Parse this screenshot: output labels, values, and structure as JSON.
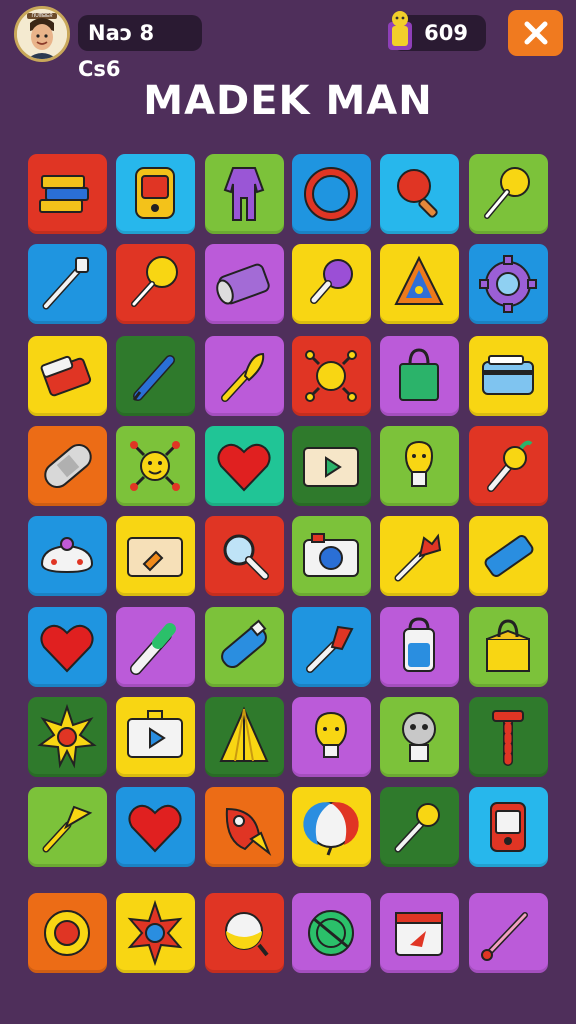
{
  "header": {
    "player_name": "Naɔ 8 Cs6",
    "coins": "609",
    "title": "MADEK MAN"
  },
  "avatar": {
    "badge_text": "ᑎᑌᗰᗷᗴᖇ"
  },
  "colors": {
    "background": "#4f2f5b",
    "red": "#e03524",
    "blue": "#1f95e0",
    "lightblue": "#27b7ec",
    "green": "#7cc23a",
    "darkgreen": "#2f7a2c",
    "yellow": "#f8d613",
    "purple": "#bb5bd9",
    "orange": "#ec6c16",
    "teal": "#20c596",
    "close": "#f07a1f"
  },
  "board": {
    "rows": [
      [
        {
          "color": "red",
          "icon": "books-icon"
        },
        {
          "color": "lightblue",
          "icon": "handheld-device-icon"
        },
        {
          "color": "green",
          "icon": "jumpsuit-icon"
        },
        {
          "color": "blue",
          "icon": "ring-icon"
        },
        {
          "color": "lightblue",
          "icon": "ping-pong-paddle-icon"
        },
        {
          "color": "green",
          "icon": "lollipop-wand-icon"
        }
      ],
      [
        {
          "color": "blue",
          "icon": "toothbrush-icon"
        },
        {
          "color": "red",
          "icon": "lollipop-icon"
        },
        {
          "color": "purple",
          "icon": "film-roll-icon"
        },
        {
          "color": "yellow",
          "icon": "maraca-icon"
        },
        {
          "color": "yellow",
          "icon": "warning-cone-icon"
        },
        {
          "color": "blue",
          "icon": "gear-icon"
        }
      ],
      [
        {
          "color": "yellow",
          "icon": "eraser-icon"
        },
        {
          "color": "darkgreen",
          "icon": "pen-icon"
        },
        {
          "color": "purple",
          "icon": "paint-brush-icon"
        },
        {
          "color": "red",
          "icon": "virus-icon"
        },
        {
          "color": "purple",
          "icon": "shopping-bag-icon"
        },
        {
          "color": "yellow",
          "icon": "wallet-icon"
        }
      ],
      [
        {
          "color": "orange",
          "icon": "bandage-icon"
        },
        {
          "color": "green",
          "icon": "bug-face-icon"
        },
        {
          "color": "teal",
          "icon": "heart-icon"
        },
        {
          "color": "darkgreen",
          "icon": "video-player-icon"
        },
        {
          "color": "green",
          "icon": "robot-bulb-icon"
        },
        {
          "color": "red",
          "icon": "torch-icon"
        }
      ],
      [
        {
          "color": "blue",
          "icon": "spaceship-icon"
        },
        {
          "color": "yellow",
          "icon": "folder-icon"
        },
        {
          "color": "red",
          "icon": "magnifier-icon"
        },
        {
          "color": "green",
          "icon": "camera-icon"
        },
        {
          "color": "yellow",
          "icon": "flower-wand-icon"
        },
        {
          "color": "yellow",
          "icon": "tube-icon"
        }
      ],
      [
        {
          "color": "blue",
          "icon": "heart-icon"
        },
        {
          "color": "purple",
          "icon": "marker-icon"
        },
        {
          "color": "green",
          "icon": "toothpaste-icon"
        },
        {
          "color": "blue",
          "icon": "brush-icon"
        },
        {
          "color": "purple",
          "icon": "jar-icon"
        },
        {
          "color": "green",
          "icon": "box-bag-icon"
        }
      ],
      [
        {
          "color": "darkgreen",
          "icon": "sun-icon"
        },
        {
          "color": "yellow",
          "icon": "play-screen-icon"
        },
        {
          "color": "darkgreen",
          "icon": "tent-icon"
        },
        {
          "color": "purple",
          "icon": "bulb-face-icon"
        },
        {
          "color": "green",
          "icon": "robot-head-icon"
        },
        {
          "color": "darkgreen",
          "icon": "candy-cane-icon"
        }
      ],
      [
        {
          "color": "green",
          "icon": "trumpet-icon"
        },
        {
          "color": "blue",
          "icon": "heart-icon"
        },
        {
          "color": "orange",
          "icon": "rocket-icon"
        },
        {
          "color": "yellow",
          "icon": "beach-ball-icon"
        },
        {
          "color": "darkgreen",
          "icon": "cotton-swab-icon"
        },
        {
          "color": "lightblue",
          "icon": "phone-icon"
        }
      ],
      [
        {
          "color": "orange",
          "icon": "life-ring-icon"
        },
        {
          "color": "yellow",
          "icon": "star-face-icon"
        },
        {
          "color": "red",
          "icon": "spinning-top-icon"
        },
        {
          "color": "purple",
          "icon": "globe-icon"
        },
        {
          "color": "purple",
          "icon": "calendar-icon"
        },
        {
          "color": "purple",
          "icon": "wand-icon"
        }
      ]
    ]
  }
}
